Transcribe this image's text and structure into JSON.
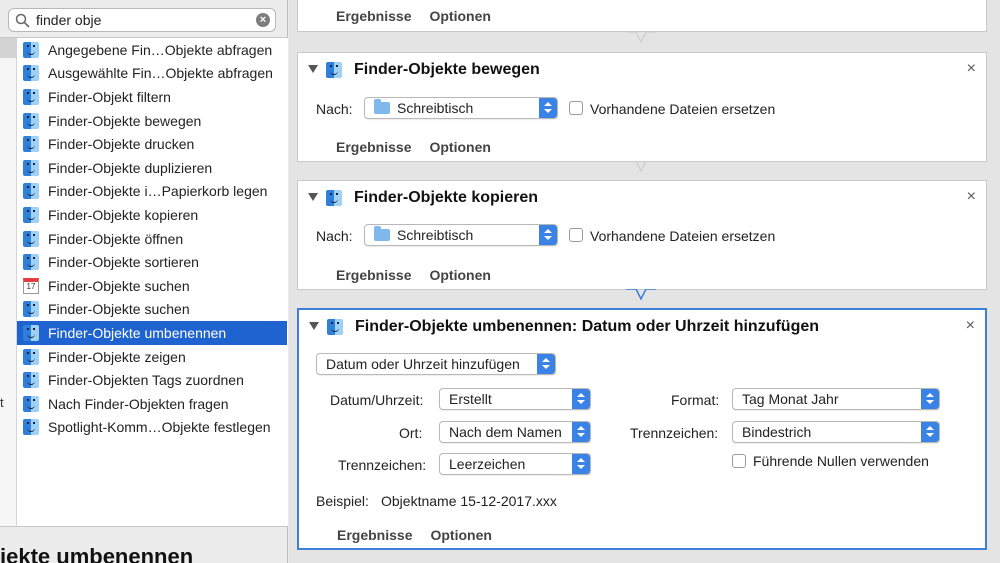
{
  "search": {
    "value": "finder obje",
    "clear_glyph": "×"
  },
  "left_gutter": [
    "t"
  ],
  "action_list": [
    {
      "label": "Angegebene Fin…Objekte abfragen",
      "icon": "finder-icon"
    },
    {
      "label": "Ausgewählte Fin…Objekte abfragen",
      "icon": "finder-icon"
    },
    {
      "label": "Finder-Objekt filtern",
      "icon": "finder-icon"
    },
    {
      "label": "Finder-Objekte bewegen",
      "icon": "finder-icon"
    },
    {
      "label": "Finder-Objekte drucken",
      "icon": "finder-icon"
    },
    {
      "label": "Finder-Objekte duplizieren",
      "icon": "finder-icon"
    },
    {
      "label": "Finder-Objekte i…Papierkorb legen",
      "icon": "finder-icon"
    },
    {
      "label": "Finder-Objekte kopieren",
      "icon": "finder-icon"
    },
    {
      "label": "Finder-Objekte öffnen",
      "icon": "finder-icon"
    },
    {
      "label": "Finder-Objekte sortieren",
      "icon": "finder-icon"
    },
    {
      "label": "Finder-Objekte suchen",
      "icon": "calendar-icon"
    },
    {
      "label": "Finder-Objekte suchen",
      "icon": "finder-icon"
    },
    {
      "label": "Finder-Objekte umbenennen",
      "icon": "finder-icon",
      "selected": true
    },
    {
      "label": "Finder-Objekte zeigen",
      "icon": "finder-icon"
    },
    {
      "label": "Finder-Objekten Tags zuordnen",
      "icon": "finder-icon"
    },
    {
      "label": "Nach Finder-Objekten fragen",
      "icon": "finder-icon"
    },
    {
      "label": "Spotlight-Komm…Objekte festlegen",
      "icon": "finder-icon"
    }
  ],
  "calendar_glyph_text": "17",
  "description_heading": "jekte umbenennen",
  "workflow": {
    "top_card": {
      "tab_results": "Ergebnisse",
      "tab_options": "Optionen"
    },
    "card_move": {
      "title": "Finder-Objekte bewegen",
      "to_label": "Nach:",
      "to_value": "Schreibtisch",
      "replace_label": "Vorhandene Dateien ersetzen",
      "tab_results": "Ergebnisse",
      "tab_options": "Optionen",
      "close_glyph": "×"
    },
    "card_copy": {
      "title": "Finder-Objekte kopieren",
      "to_label": "Nach:",
      "to_value": "Schreibtisch",
      "replace_label": "Vorhandene Dateien ersetzen",
      "tab_results": "Ergebnisse",
      "tab_options": "Optionen",
      "close_glyph": "×"
    },
    "card_rename": {
      "title": "Finder-Objekte umbenennen: Datum oder Uhrzeit hinzufügen",
      "mode_value": "Datum oder Uhrzeit hinzufügen",
      "datetime_label": "Datum/Uhrzeit:",
      "datetime_value": "Erstellt",
      "location_label": "Ort:",
      "location_value": "Nach dem Namen",
      "separator_label": "Trennzeichen:",
      "separator_value": "Leerzeichen",
      "format_label": "Format:",
      "format_value": "Tag Monat Jahr",
      "separator2_label": "Trennzeichen:",
      "separator2_value": "Bindestrich",
      "leading_zeros_label": "Führende Nullen verwenden",
      "example_label": "Beispiel:",
      "example_value": "Objektname 15-12-2017.xxx",
      "tab_results": "Ergebnisse",
      "tab_options": "Optionen",
      "close_glyph": "×"
    }
  },
  "colors": {
    "selection": "#1e63cf",
    "accent": "#3b82e6",
    "selected_border": "#3b7fd9"
  }
}
